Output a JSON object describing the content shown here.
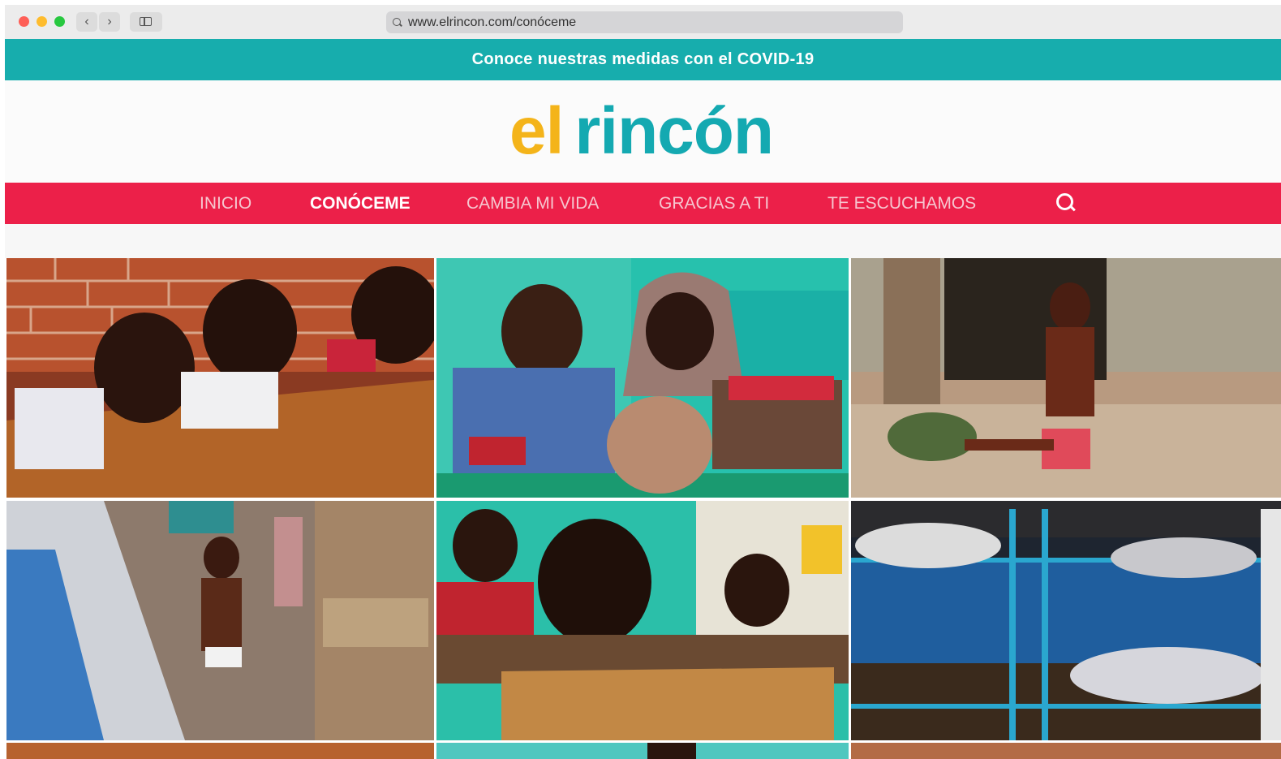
{
  "browser": {
    "url": "www.elrincon.com/conóceme",
    "back_icon": "chevron-left-icon",
    "forward_icon": "chevron-right-icon",
    "sidebar_icon": "sidebar-icon"
  },
  "banner": {
    "text": "Conoce nuestras medidas con el COVID-19",
    "color": "#17adad"
  },
  "logo": {
    "part1": "el",
    "part2": "rincón",
    "color1": "#f4b41a",
    "color2": "#14a9b1"
  },
  "nav": {
    "color": "#ec2049",
    "items": [
      {
        "label": "INICIO",
        "active": false
      },
      {
        "label": "CONÓCEME",
        "active": true
      },
      {
        "label": "CAMBIA MI VIDA",
        "active": false
      },
      {
        "label": "GRACIAS A TI",
        "active": false
      },
      {
        "label": "TE ESCUCHAMOS",
        "active": false
      }
    ],
    "search_icon": "search-icon"
  },
  "gallery": {
    "photos": [
      {
        "subject": "three children resting heads on a wooden desk"
      },
      {
        "subject": "children in classroom with teal wall"
      },
      {
        "subject": "small child sitting on a red potty outdoors"
      },
      {
        "subject": "child standing in a crowded street"
      },
      {
        "subject": "boy behind a wooden school desk"
      },
      {
        "subject": "metal bunk beds in a dormitory"
      }
    ]
  }
}
